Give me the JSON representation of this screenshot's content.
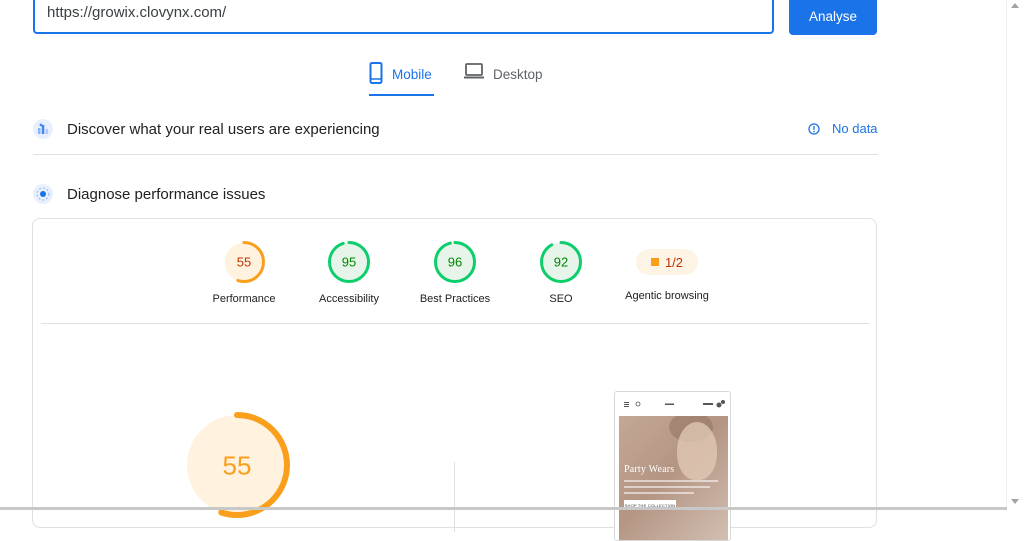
{
  "search": {
    "url_value": "https://growix.clovynx.com/",
    "analyse_label": "Analyse"
  },
  "device_tabs": [
    {
      "label": "Mobile",
      "icon": "smartphone-icon",
      "selected": true
    },
    {
      "label": "Desktop",
      "icon": "laptop-icon",
      "selected": false
    }
  ],
  "real_users": {
    "title": "Discover what your real users are experiencing",
    "status_label": "No data",
    "icon": "crux-chart-icon"
  },
  "diagnose": {
    "title": "Diagnose performance issues",
    "icon": "lighthouse-icon"
  },
  "scores": [
    {
      "value": "55",
      "label": "Performance",
      "fraction": 0.55,
      "color": "#fa9f1b",
      "text_color": "#c33300",
      "bg": "#fff3e0"
    },
    {
      "value": "95",
      "label": "Accessibility",
      "fraction": 0.95,
      "color": "#0cce6b",
      "text_color": "#008800",
      "bg": "#e6f4ea"
    },
    {
      "value": "96",
      "label": "Best Practices",
      "fraction": 0.96,
      "color": "#0cce6b",
      "text_color": "#008800",
      "bg": "#e6f4ea"
    },
    {
      "value": "92",
      "label": "SEO",
      "fraction": 0.92,
      "color": "#0cce6b",
      "text_color": "#008800",
      "bg": "#e6f4ea"
    }
  ],
  "agentic": {
    "value": "1/2",
    "label": "Agentic browsing",
    "color": "#fa9f1b"
  },
  "main_score": {
    "value": "55",
    "fraction": 0.55,
    "color": "#fa9f1b",
    "bg": "#fff3e0"
  },
  "screenshot": {
    "hero_text": "Party Wears",
    "button_text": "SHOP THE COLLECTION"
  },
  "colors": {
    "accent": "#1a73e8",
    "pass": "#0cce6b",
    "average": "#fa9f1b"
  }
}
